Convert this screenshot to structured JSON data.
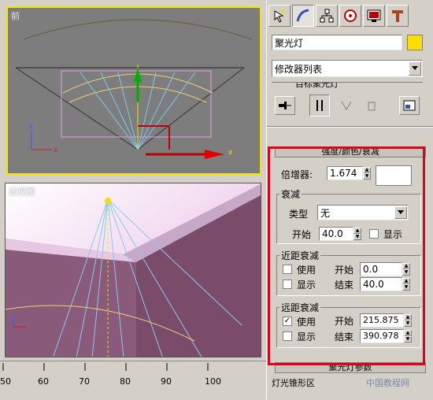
{
  "viewports": {
    "top_label": "前",
    "persp_label": "透视图"
  },
  "ruler": {
    "ticks": [
      "50",
      "60",
      "70",
      "80",
      "90",
      "100"
    ]
  },
  "panel": {
    "object_name": "聚光灯",
    "object_color": "#ffdd00",
    "modifier_list": "修改器列表",
    "stack_item": "目标聚光灯",
    "rollout_intensity": "强度/颜色/衰减",
    "multiplier_label": "倍增器:",
    "multiplier_value": "1.674",
    "decay": {
      "title": "衰减",
      "type_label": "类型",
      "type_value": "无",
      "start_label": "开始",
      "start_value": "40.0",
      "show_label": "显示"
    },
    "near_atten": {
      "title": "近距衰减",
      "use_label": "使用",
      "show_label": "显示",
      "start_label": "开始",
      "start_value": "0.0",
      "end_label": "结束",
      "end_value": "40.0"
    },
    "far_atten": {
      "title": "远距衰减",
      "use_label": "使用",
      "show_label": "显示",
      "start_label": "开始",
      "start_value": "215.875",
      "end_label": "结束",
      "end_value": "390.978"
    },
    "rollout_spot": "聚光灯参数",
    "rollout_cone": "灯光锥形区",
    "watermark": "中国教程网"
  }
}
